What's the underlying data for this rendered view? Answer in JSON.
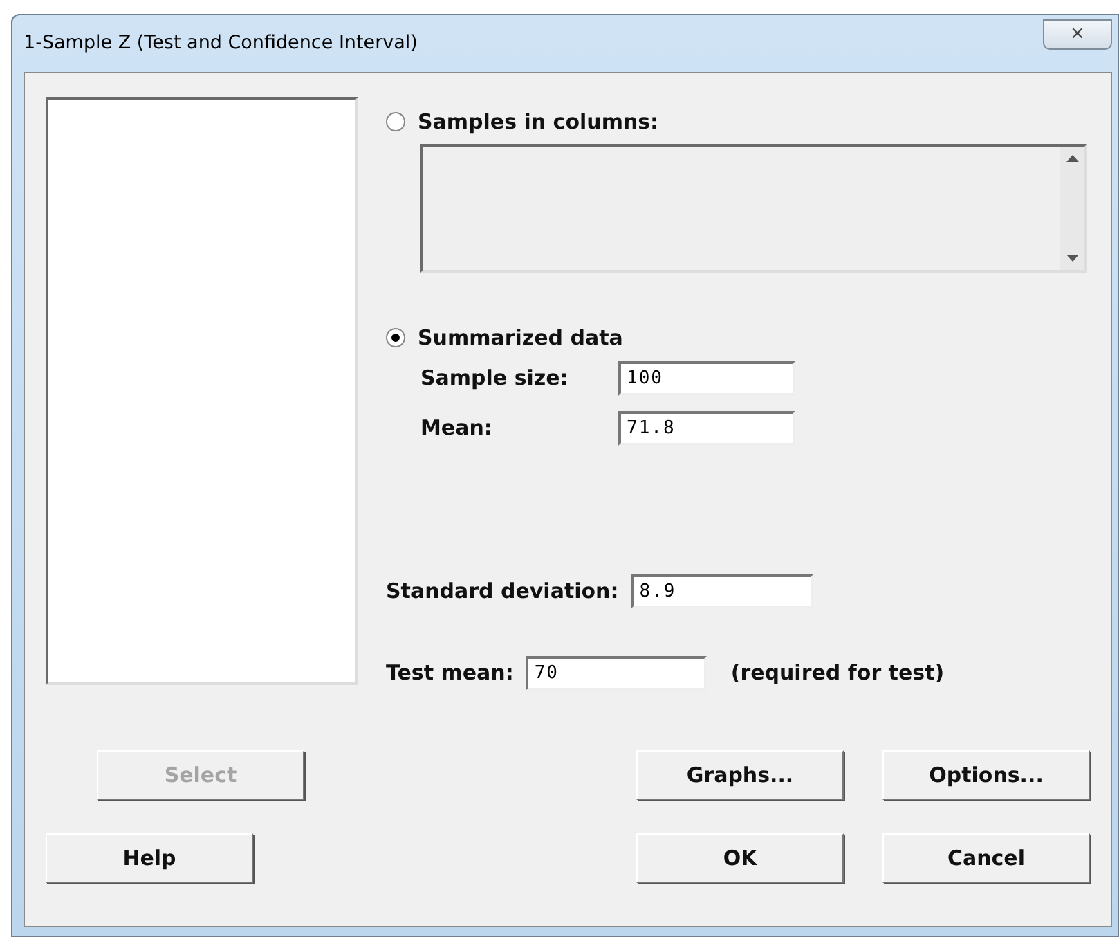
{
  "window": {
    "title": "1-Sample Z (Test and Confidence Interval)",
    "close": "⨯"
  },
  "radios": [
    {
      "label": "Samples in columns:",
      "selected": false
    },
    {
      "label": "Summarized data",
      "selected": true
    }
  ],
  "summarized_fields": [
    {
      "label": "Sample size:",
      "value": "100"
    },
    {
      "label": "Mean:",
      "value": "71.8"
    }
  ],
  "standard_deviation": {
    "label": "Standard deviation:",
    "value": "8.9"
  },
  "test_mean": {
    "label": "Test mean:",
    "value": "70",
    "note": "(required for test)"
  },
  "buttons": [
    {
      "label": "Select",
      "disabled": true
    },
    {
      "label": "Graphs...",
      "disabled": false
    },
    {
      "label": "Options...",
      "disabled": false
    },
    {
      "label": "Help",
      "disabled": false
    },
    {
      "label": "OK",
      "disabled": false
    },
    {
      "label": "Cancel",
      "disabled": false
    }
  ]
}
